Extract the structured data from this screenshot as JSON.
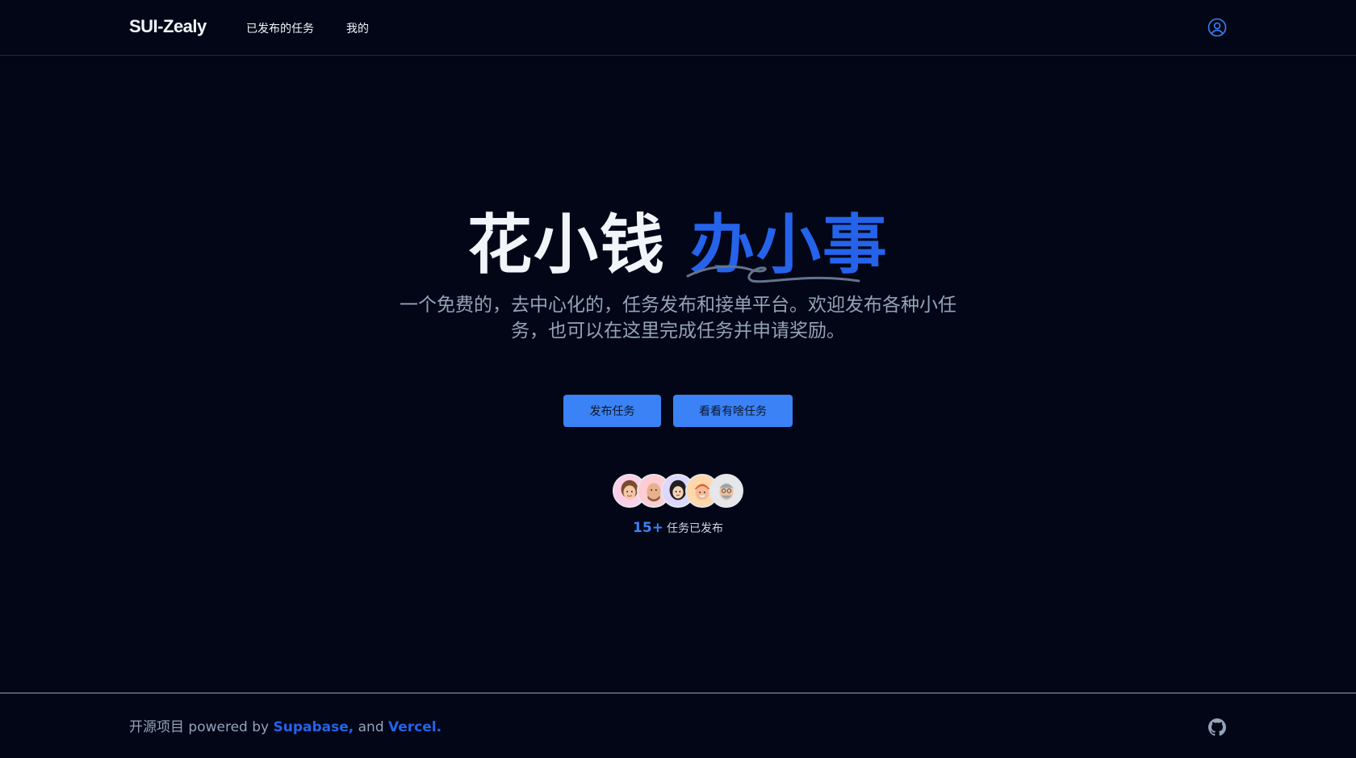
{
  "header": {
    "brand": "SUI-Zealy",
    "nav": [
      "已发布的任务",
      "我的"
    ]
  },
  "hero": {
    "title_part1": "花小钱",
    "title_part2": "办小事",
    "subtitle": "一个免费的，去中心化的，任务发布和接单平台。欢迎发布各种小任务，也可以在这里完成任务并申请奖励。",
    "primary_button": "发布任务",
    "secondary_button": "看看有啥任务"
  },
  "stats": {
    "count": "15+",
    "label": "任务已发布"
  },
  "footer": {
    "prefix": "开源项目 powered by",
    "link1": "Supabase,",
    "middle": "and",
    "link2": "Vercel."
  },
  "colors": {
    "background": "#020617",
    "accent": "#2563eb",
    "button": "#3b82f6",
    "muted": "#94a3b8"
  },
  "icons": {
    "user": "user-circle-icon",
    "github": "github-icon"
  }
}
